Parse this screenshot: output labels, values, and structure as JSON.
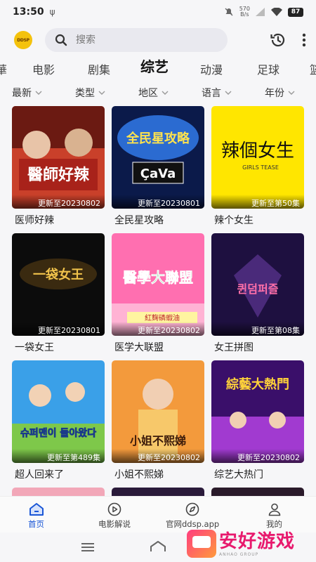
{
  "status_bar": {
    "time": "13:50",
    "speed_value": "570",
    "speed_unit": "B/s",
    "battery": "87"
  },
  "header": {
    "logo_text": "DDSP",
    "search_placeholder": "搜索"
  },
  "category_tabs": [
    {
      "label": "華"
    },
    {
      "label": "电影"
    },
    {
      "label": "剧集"
    },
    {
      "label": "综艺",
      "active": true
    },
    {
      "label": "动漫"
    },
    {
      "label": "足球"
    },
    {
      "label": "篮"
    }
  ],
  "filters": [
    {
      "label": "最新"
    },
    {
      "label": "类型"
    },
    {
      "label": "地区"
    },
    {
      "label": "语言"
    },
    {
      "label": "年份"
    }
  ],
  "shows": [
    {
      "title": "医师好辣",
      "update": "更新至20230802",
      "art_text": "醫師好辣",
      "bg": [
        "#6b1a12",
        "#c9402a"
      ],
      "fg": "#ffffff"
    },
    {
      "title": "全民星攻略",
      "update": "更新至20230801",
      "art_text": "全民星攻略",
      "bg": [
        "#0b1a4a",
        "#2b6bd1"
      ],
      "fg": "#ffe34d"
    },
    {
      "title": "辣个女生",
      "update": "更新至第50集",
      "art_text": "辣個女生",
      "bg": [
        "#ffe600",
        "#ffd400"
      ],
      "fg": "#111111"
    },
    {
      "title": "一袋女王",
      "update": "更新至20230801",
      "art_text": "一袋女王",
      "bg": [
        "#0c0c0c",
        "#3a2a10"
      ],
      "fg": "#f0c24b"
    },
    {
      "title": "医学大联盟",
      "update": "更新至20230802",
      "art_text": "醫學大聯盟",
      "bg": [
        "#ff6fb0",
        "#ffb3d4"
      ],
      "fg": "#1aa84a"
    },
    {
      "title": "女王拼图",
      "update": "更新至第08集",
      "art_text": "퀸덤퍼즐",
      "bg": [
        "#1e1040",
        "#4a2a7a"
      ],
      "fg": "#ff6fa8"
    },
    {
      "title": "超人回来了",
      "update": "更新至第489集",
      "art_text": "슈퍼맨이 돌아왔다",
      "bg": [
        "#3aa0e8",
        "#7ec84a"
      ],
      "fg": "#ffffff"
    },
    {
      "title": "小姐不熙娣",
      "update": "更新至20230802",
      "art_text": "小姐不熙娣",
      "bg": [
        "#f39a3c",
        "#f7c86a"
      ],
      "fg": "#3a1a0a"
    },
    {
      "title": "综艺大热门",
      "update": "更新至20230802",
      "art_text": "綜藝大熱門",
      "bg": [
        "#3a0f6a",
        "#a13ad0"
      ],
      "fg": "#ffd23a"
    }
  ],
  "partial_row_colors": [
    "#f2a7b8",
    "#2a1a3a",
    "#2a1a2a"
  ],
  "bottom_nav": [
    {
      "label": "首页",
      "icon": "home-icon",
      "active": true
    },
    {
      "label": "电影解说",
      "icon": "play-circle-icon"
    },
    {
      "label": "官网ddsp.app",
      "icon": "compass-icon"
    },
    {
      "label": "我的",
      "icon": "user-icon"
    }
  ],
  "watermark": {
    "title": "安好游戏",
    "subtitle": "ANHAO GROUP"
  },
  "colors": {
    "accent": "#1a56d6",
    "background": "#f6f6f8"
  }
}
